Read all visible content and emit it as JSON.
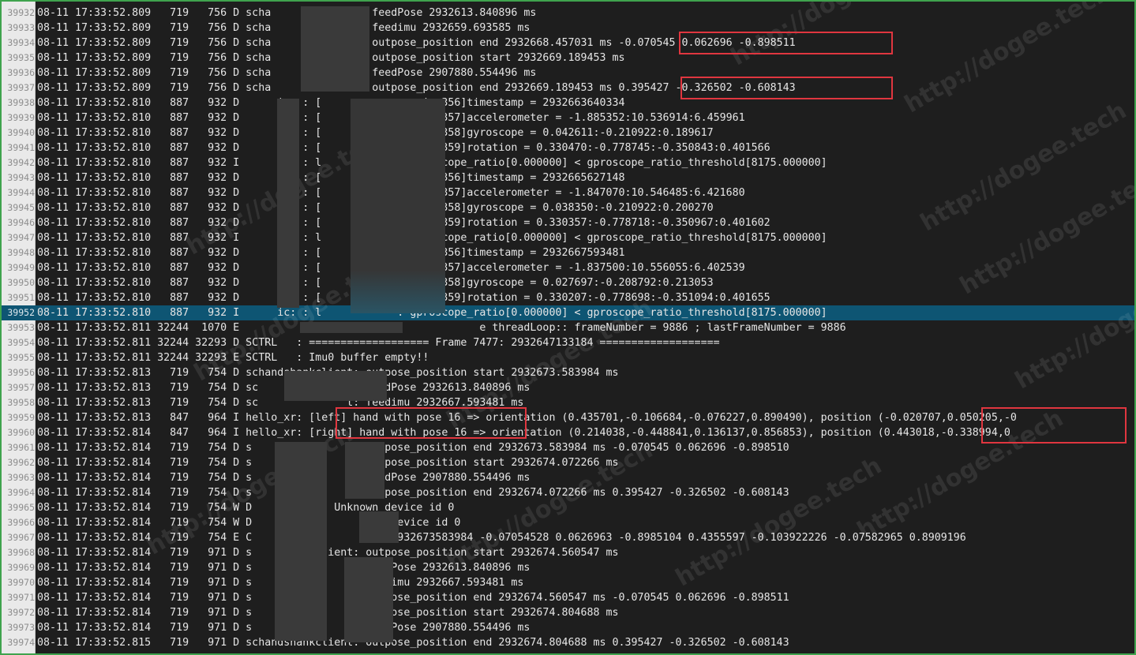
{
  "watermark": "http://dogee.tech",
  "colors": {
    "background": "#1e1e1e",
    "selection": "#0e5573",
    "highlight_box": "#e0363f",
    "frame": "#3fa34d"
  },
  "lines": [
    {
      "n": "39932",
      "t": "08-11 17:33:52.809   719   756 D scha          ient: feedPose 2932613.840896 ms"
    },
    {
      "n": "39933",
      "t": "08-11 17:33:52.809   719   756 D scha          ient: feedimu 2932659.693585 ms"
    },
    {
      "n": "39934",
      "t": "08-11 17:33:52.809   719   756 D scha          ient: outpose_position end 2932668.457031 ms -0.070545 0.062696 -0.898511"
    },
    {
      "n": "39935",
      "t": "08-11 17:33:52.809   719   756 D scha          ient: outpose_position start 2932669.189453 ms"
    },
    {
      "n": "39936",
      "t": "08-11 17:33:52.809   719   756 D scha          ient: feedPose 2907880.554496 ms"
    },
    {
      "n": "39937",
      "t": "08-11 17:33:52.809   719   756 D scha          ient: outpose_position end 2932669.189453 ms 0.395427 -0.326502 -0.608143"
    },
    {
      "n": "39938",
      "t": "08-11 17:33:52.810   887   932 D      ic: : [              main:356]timestamp = 2932663640334"
    },
    {
      "n": "39939",
      "t": "08-11 17:33:52.810   887   932 D      ic: : [              main:357]accelerometer = -1.885352:10.536914:6.459961"
    },
    {
      "n": "39940",
      "t": "08-11 17:33:52.810   887   932 D      ic: : [              main:358]gyroscope = 0.042611:-0.210922:0.189617"
    },
    {
      "n": "39941",
      "t": "08-11 17:33:52.810   887   932 D      ic: : [              main:359]rotation = 0.330470:-0.778745:-0.350843:0.401566"
    },
    {
      "n": "39942",
      "t": "08-11 17:33:52.810   887   932 I      ic: : l            : gproscope_ratio[0.000000] < gproscope_ratio_threshold[8175.000000]"
    },
    {
      "n": "39943",
      "t": "08-11 17:33:52.810   887   932 D      ic: : [              main:356]timestamp = 2932665627148"
    },
    {
      "n": "39944",
      "t": "08-11 17:33:52.810   887   932 D      ic: : [              main:357]accelerometer = -1.847070:10.546485:6.421680"
    },
    {
      "n": "39945",
      "t": "08-11 17:33:52.810   887   932 D      ic: : [              main:358]gyroscope = 0.038350:-0.210922:0.200270"
    },
    {
      "n": "39946",
      "t": "08-11 17:33:52.810   887   932 D      ic: : [              main:359]rotation = 0.330357:-0.778718:-0.350967:0.401602"
    },
    {
      "n": "39947",
      "t": "08-11 17:33:52.810   887   932 I      ic: : l            : gproscope_ratio[0.000000] < gproscope_ratio_threshold[8175.000000]"
    },
    {
      "n": "39948",
      "t": "08-11 17:33:52.810   887   932 D      ic: : [              main:356]timestamp = 2932667593481"
    },
    {
      "n": "39949",
      "t": "08-11 17:33:52.810   887   932 D      ic: : [              main:357]accelerometer = -1.837500:10.556055:6.402539"
    },
    {
      "n": "39950",
      "t": "08-11 17:33:52.810   887   932 D      ic: : [              main:358]gyroscope = 0.027697:-0.208792:0.213053"
    },
    {
      "n": "39951",
      "t": "08-11 17:33:52.810   887   932 D      ic: : [              main:359]rotation = 0.330207:-0.778698:-0.351094:0.401655"
    },
    {
      "n": "39952",
      "t": "08-11 17:33:52.810   887   932 I      ic: : l            : gproscope_ratio[0.000000] < gproscope_ratio_threshold[8175.000000]"
    },
    {
      "n": "39953",
      "t": "08-11 17:33:52.811 32244  1070 E                   e: h               e threadLoop:: frameNumber = 9886 ; lastFrameNumber = 9886"
    },
    {
      "n": "39954",
      "t": "08-11 17:33:52.811 32244 32293 D SCTRL   : =================== Frame 7477: 2932647133184 ==================="
    },
    {
      "n": "39955",
      "t": "08-11 17:33:52.811 32244 32293 E SCTRL   : Imu0 buffer empty!!"
    },
    {
      "n": "39956",
      "t": "08-11 17:33:52.813   719   754 D schandshankclient: outpose_position start 2932673.583984 ms"
    },
    {
      "n": "39957",
      "t": "08-11 17:33:52.813   719   754 D sc              t: feedPose 2932613.840896 ms"
    },
    {
      "n": "39958",
      "t": "08-11 17:33:52.813   719   754 D sc              t: feedimu 2932667.593481 ms"
    },
    {
      "n": "39959",
      "t": "08-11 17:33:52.813   847   964 I hello_xr: [left] hand with pose 16 => orientation (0.435701,-0.106684,-0.076227,0.890490), position (-0.020707,0.050205,-0"
    },
    {
      "n": "39960",
      "t": "08-11 17:33:52.814   847   964 I hello_xr: [right] hand with pose 16 => orientation (0.214038,-0.448841,0.136137,0.856853), position (0.443018,-0.338994,0"
    },
    {
      "n": "39961",
      "t": "08-11 17:33:52.814   719   754 D s       an      t: outpose_position end 2932673.583984 ms -0.070545 0.062696 -0.898510"
    },
    {
      "n": "39962",
      "t": "08-11 17:33:52.814   719   754 D s       an      t: outpose_position start 2932674.072266 ms"
    },
    {
      "n": "39963",
      "t": "08-11 17:33:52.814   719   754 D s       an      t: feedPose 2907880.554496 ms"
    },
    {
      "n": "39964",
      "t": "08-11 17:33:52.814   719   754 D s       an      t: outpose_position end 2932674.072266 ms 0.395427 -0.326502 -0.608143"
    },
    {
      "n": "39965",
      "t": "08-11 17:33:52.814   719   754 W D       nage: Unknown device id 0"
    },
    {
      "n": "39966",
      "t": "08-11 17:33:52.814   719   754 W D       nage      nown device id 0"
    },
    {
      "n": "39967",
      "t": "08-11 17:33:52.814   719   754 E C       erIn      ice: 2932673583984 -0.07054528 0.0626963 -0.8985104 0.4355597 -0.103922226 -0.07582965 0.8909196"
    },
    {
      "n": "39968",
      "t": "08-11 17:33:52.814   719   971 D s       ankclient: outpose_position start 2932674.560547 ms"
    },
    {
      "n": "39969",
      "t": "08-11 17:33:52.814   719   971 D s       ank     t: feedPose 2932613.840896 ms"
    },
    {
      "n": "39970",
      "t": "08-11 17:33:52.814   719   971 D s       ank     t: feedimu 2932667.593481 ms"
    },
    {
      "n": "39971",
      "t": "08-11 17:33:52.814   719   971 D s       ank     t: outpose_position end 2932674.560547 ms -0.070545 0.062696 -0.898511"
    },
    {
      "n": "39972",
      "t": "08-11 17:33:52.814   719   971 D s       ank     t: outpose_position start 2932674.804688 ms"
    },
    {
      "n": "39973",
      "t": "08-11 17:33:52.814   719   971 D s       ank     t: feedPose 2907880.554496 ms"
    },
    {
      "n": "39974",
      "t": "08-11 17:33:52.815   719   971 D schandshankclient: outpose_position end 2932674.804688 ms 0.395427 -0.326502 -0.608143"
    }
  ]
}
